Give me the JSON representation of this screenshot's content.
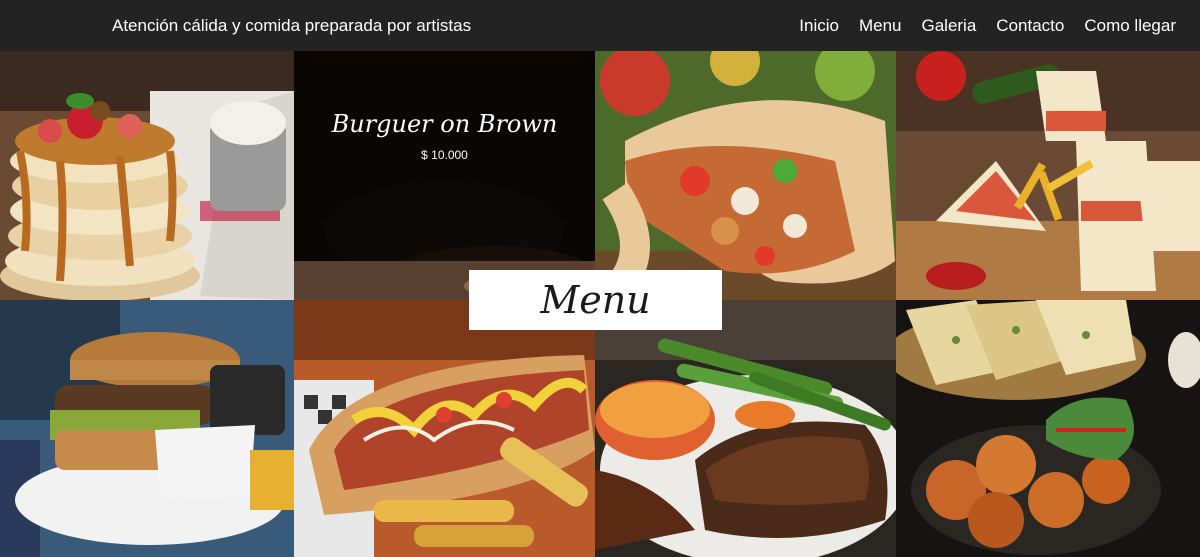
{
  "header": {
    "tagline": "Atención cálida y comida preparada por artistas",
    "nav": [
      "Inicio",
      "Menu",
      "Galeria",
      "Contacto",
      "Como llegar"
    ]
  },
  "featured": {
    "name": "Burguer on Brown",
    "price": "$ 10.000"
  },
  "menu_banner": "Menu",
  "colors": {
    "header_bg": "#232323",
    "header_text": "#ffffff",
    "banner_bg": "#ffffff"
  }
}
